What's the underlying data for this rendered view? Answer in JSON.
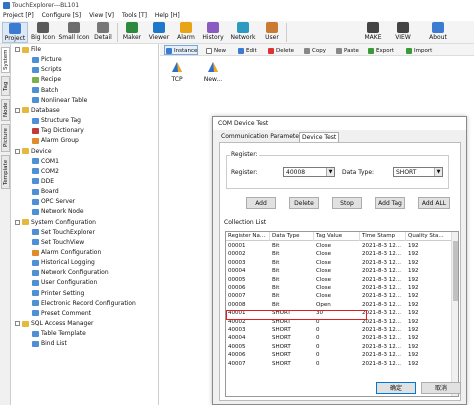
{
  "window": {
    "title": "TouchExplorer---BL101"
  },
  "menu": [
    "Project [P]",
    "Configure [S]",
    "View [V]",
    "Tools [T]",
    "Help [H]"
  ],
  "toolbar": [
    "Project",
    "Big Icon",
    "Small Icon",
    "Detail",
    "Maker",
    "Viewer",
    "Alarm",
    "History",
    "Network",
    "User",
    "MAKE",
    "VIEW",
    "About"
  ],
  "side_tabs": [
    "System",
    "Tag",
    "Node",
    "Picture",
    "Template"
  ],
  "tree": [
    {
      "label": "File",
      "level": 0,
      "color": "#e6b93c"
    },
    {
      "label": "Picture",
      "level": 1,
      "color": "#4f8fd6"
    },
    {
      "label": "Scripts",
      "level": 1,
      "color": "#4f8fd6"
    },
    {
      "label": "Recipe",
      "level": 1,
      "color": "#7bb04a"
    },
    {
      "label": "Batch",
      "level": 1,
      "color": "#4f8fd6"
    },
    {
      "label": "Nonlinear Table",
      "level": 1,
      "color": "#4f8fd6"
    },
    {
      "label": "Database",
      "level": 0,
      "color": "#e6b93c"
    },
    {
      "label": "Structure Tag",
      "level": 1,
      "color": "#4f8fd6"
    },
    {
      "label": "Tag Dictionary",
      "level": 1,
      "color": "#c23b3b"
    },
    {
      "label": "Alarm Group",
      "level": 1,
      "color": "#e08a2c"
    },
    {
      "label": "Device",
      "level": 0,
      "color": "#e6b93c"
    },
    {
      "label": "COM1",
      "level": 1,
      "color": "#4f8fd6"
    },
    {
      "label": "COM2",
      "level": 1,
      "color": "#4f8fd6"
    },
    {
      "label": "DDE",
      "level": 1,
      "color": "#4f8fd6"
    },
    {
      "label": "Board",
      "level": 1,
      "color": "#4f8fd6"
    },
    {
      "label": "OPC Server",
      "level": 1,
      "color": "#4f8fd6"
    },
    {
      "label": "Network Node",
      "level": 1,
      "color": "#4f8fd6"
    },
    {
      "label": "System Configuration",
      "level": 0,
      "color": "#e6b93c"
    },
    {
      "label": "Set TouchExplorer",
      "level": 1,
      "color": "#4f8fd6"
    },
    {
      "label": "Set TouchView",
      "level": 1,
      "color": "#4f8fd6"
    },
    {
      "label": "Alarm Configuration",
      "level": 1,
      "color": "#e08a2c"
    },
    {
      "label": "Historical Logging",
      "level": 1,
      "color": "#4f8fd6"
    },
    {
      "label": "Network Configuration",
      "level": 1,
      "color": "#4f8fd6"
    },
    {
      "label": "User Configuration",
      "level": 1,
      "color": "#4f8fd6"
    },
    {
      "label": "Printer Setting",
      "level": 1,
      "color": "#4f8fd6"
    },
    {
      "label": "Electronic Record Configuration",
      "level": 1,
      "color": "#4f8fd6"
    },
    {
      "label": "Preset Comment",
      "level": 1,
      "color": "#4f8fd6"
    },
    {
      "label": "SQL Access Manager",
      "level": 0,
      "color": "#e6b93c"
    },
    {
      "label": "Table Template",
      "level": 1,
      "color": "#4f8fd6"
    },
    {
      "label": "Bind List",
      "level": 1,
      "color": "#4f8fd6"
    }
  ],
  "content_toolbar": [
    "Instance",
    "New",
    "Edit",
    "Delete",
    "Copy",
    "Paste",
    "Export",
    "Import"
  ],
  "devices": [
    "TCP",
    "New..."
  ],
  "dialog": {
    "title": "COM Device Test",
    "tabs": [
      "Communication Parameter:",
      "Device Test"
    ],
    "register_group": "Register:",
    "register_label": "Register:",
    "register_value": "40008",
    "datatype_label": "Data Type:",
    "datatype_value": "SHORT",
    "buttons": [
      "Add",
      "Delete",
      "Stop",
      "Add Tag",
      "Add ALL"
    ],
    "collection_label": "Collection List",
    "columns": [
      "Register Na...",
      "Data Type",
      "Tag Value",
      "Time Stamp",
      "Quality Sta..."
    ],
    "rows": [
      [
        "00001",
        "Bit",
        "Close",
        "2021-8-3 12...",
        "192"
      ],
      [
        "00002",
        "Bit",
        "Close",
        "2021-8-3 12...",
        "192"
      ],
      [
        "00003",
        "Bit",
        "Close",
        "2021-8-3 12...",
        "192"
      ],
      [
        "00004",
        "Bit",
        "Close",
        "2021-8-3 12...",
        "192"
      ],
      [
        "00005",
        "Bit",
        "Close",
        "2021-8-3 12...",
        "192"
      ],
      [
        "00006",
        "Bit",
        "Close",
        "2021-8-3 12...",
        "192"
      ],
      [
        "00007",
        "Bit",
        "Close",
        "2021-8-3 12...",
        "192"
      ],
      [
        "00008",
        "Bit",
        "Open",
        "2021-8-3 12...",
        "192"
      ],
      [
        "40001",
        "SHORT",
        "30",
        "2021-8-3 12...",
        "192"
      ],
      [
        "40002",
        "SHORT",
        "0",
        "2021-8-3 12...",
        "192"
      ],
      [
        "40003",
        "SHORT",
        "0",
        "2021-8-3 12...",
        "192"
      ],
      [
        "40004",
        "SHORT",
        "0",
        "2021-8-3 12...",
        "192"
      ],
      [
        "40005",
        "SHORT",
        "0",
        "2021-8-3 12...",
        "192"
      ],
      [
        "40006",
        "SHORT",
        "0",
        "2021-8-3 12...",
        "192"
      ],
      [
        "40007",
        "SHORT",
        "0",
        "2021-8-3 12...",
        "192"
      ]
    ],
    "highlighted_register": "40001",
    "ok_label": "确定",
    "cancel_label": "取消"
  },
  "colors": {
    "highlight": "#e01e1e",
    "accent": "#0078d7"
  }
}
